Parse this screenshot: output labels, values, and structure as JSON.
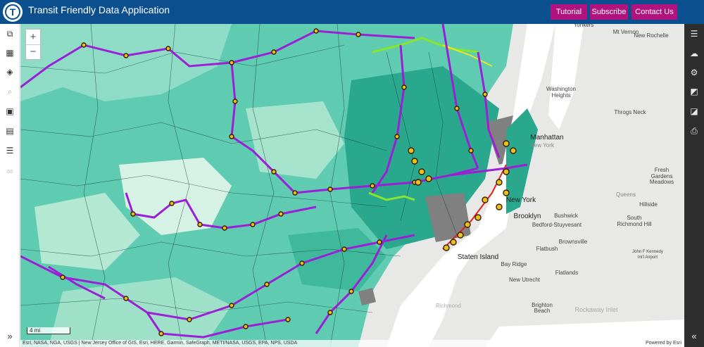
{
  "header": {
    "logo_letter": "T",
    "title": "Transit Friendly Data Application",
    "buttons": [
      "Tutorial",
      "Subscribe",
      "Contact Us"
    ]
  },
  "left_toolbar": {
    "icons": [
      "layers-list-icon",
      "building-icon",
      "stack-icon",
      "search-icon",
      "qr-code-icon",
      "save-icon",
      "list-icon",
      "link-icon"
    ],
    "expand_label": "»"
  },
  "right_toolbar": {
    "icons": [
      "legend-icon",
      "upload-icon",
      "gear-icon",
      "basemap-icon",
      "opacity-icon",
      "print-icon"
    ],
    "collapse_label": "«"
  },
  "map": {
    "zoom_in": "+",
    "zoom_out": "−",
    "scale_label": "4 mi",
    "attribution": "Esri, NASA, NGA, USGS | New Jersey Office of GIS, Esri, HERE, Garmin, SafeGraph, METI/NASA, USGS, EPA, NPS, USDA",
    "powered_by": "Powered by Esri",
    "labels": [
      "Yonkers",
      "Mt Vernon",
      "New Rochelle",
      "Washington Heights",
      "Throgs Neck",
      "Manhattan",
      "New York",
      "Fresh Gardens Meadows",
      "Queens",
      "Hillside",
      "Brooklyn",
      "Bushwick",
      "Bedford-Stuyvesant",
      "South Richmond Hill",
      "Brownsville",
      "Flatbush",
      "Staten Island",
      "Bay Ridge",
      "Flatlands",
      "New Utrecht",
      "Brighton Beach",
      "Richmond",
      "Rockaway Inlet",
      "John F Kennedy Int'l Airport"
    ]
  },
  "colors": {
    "header": "#0b4f8f",
    "button": "#b0127e",
    "transit_line": "#9b1fd6",
    "station": "#e8c21a",
    "tract_dark": "#2bb89a",
    "tract_mid": "#7dd6c0",
    "tract_light": "#c9eedd",
    "water": "#ffffff",
    "land_ny": "#e8e8e6"
  }
}
